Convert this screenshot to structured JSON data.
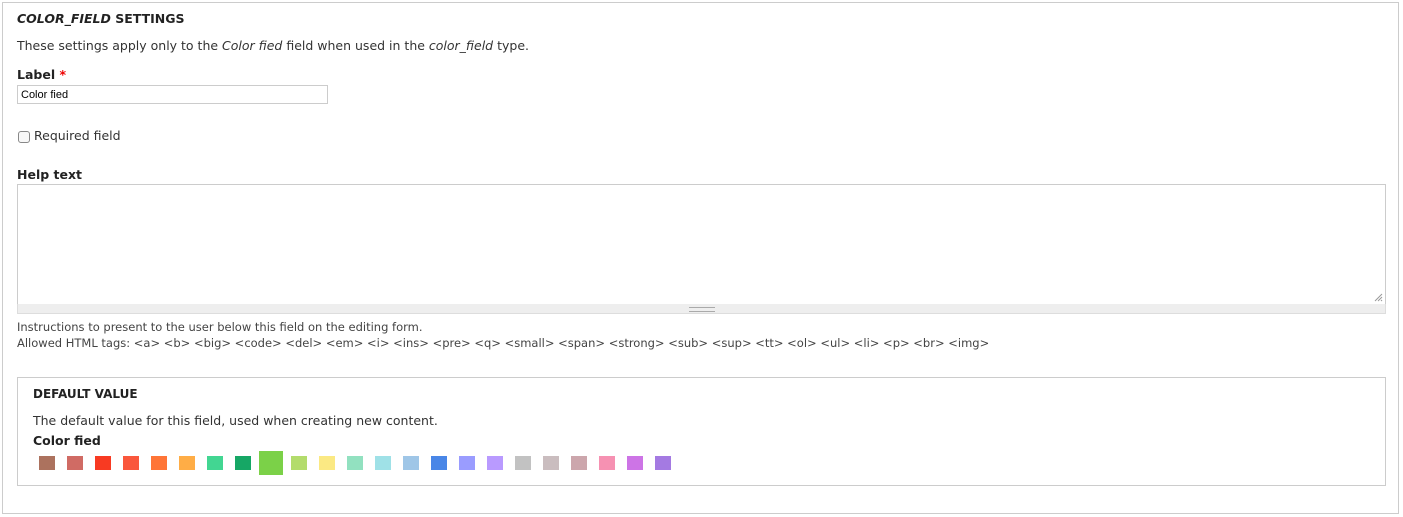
{
  "title": {
    "italic": "COLOR_FIELD",
    "rest": " SETTINGS"
  },
  "description": {
    "p1": "These settings apply only to the ",
    "i1": "Color fied",
    "p2": " field when used in the ",
    "i2": "color_field",
    "p3": " type."
  },
  "label_field": {
    "label": "Label",
    "required_mark": "*",
    "value": "Color fied"
  },
  "required_checkbox": {
    "label": "Required field",
    "checked": false
  },
  "help_text": {
    "label": "Help text",
    "value": "",
    "description": "Instructions to present to the user below this field on the editing form.",
    "allowed_tags": "Allowed HTML tags: <a> <b> <big> <code> <del> <em> <i> <ins> <pre> <q> <small> <span> <strong> <sub> <sup> <tt> <ol> <ul> <li> <p> <br> <img>"
  },
  "default_value": {
    "legend": "DEFAULT VALUE",
    "description": "The default value for this field, used when creating new content.",
    "field_label": "Color fied",
    "selected_index": 8,
    "colors": [
      "#AC725E",
      "#D06B64",
      "#F83A22",
      "#FA573C",
      "#FF7537",
      "#FFAD46",
      "#42D692",
      "#16A765",
      "#7BD148",
      "#B3DC6C",
      "#FBE983",
      "#92E1C0",
      "#9FE1E7",
      "#9FC6E7",
      "#4986E7",
      "#9A9CFF",
      "#B99AFF",
      "#C2C2C2",
      "#CABDBF",
      "#CCA6AC",
      "#F691B2",
      "#CD74E6",
      "#A47AE2"
    ]
  }
}
